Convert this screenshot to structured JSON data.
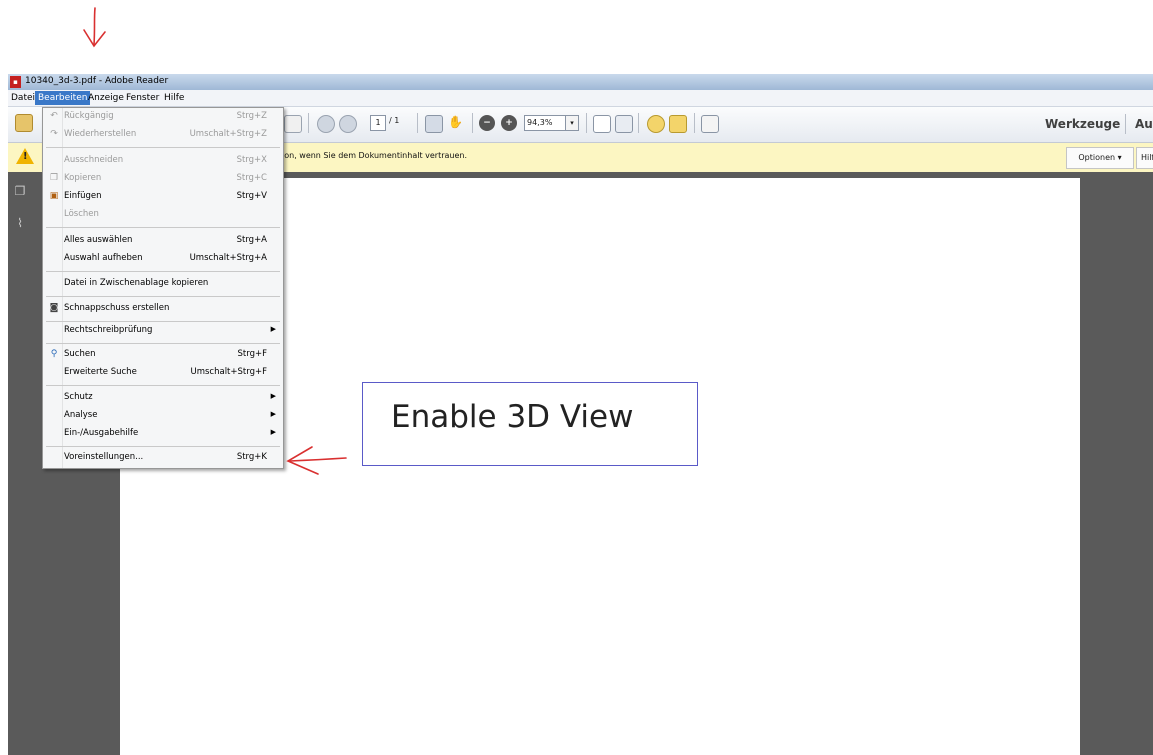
{
  "window": {
    "title": "10340_3d-3.pdf - Adobe Reader",
    "app_icon": "pdf-icon"
  },
  "menubar": {
    "items": [
      "Datei",
      "Bearbeiten",
      "Anzeige",
      "Fenster",
      "Hilfe"
    ],
    "active": "Bearbeiten"
  },
  "toolbar": {
    "page_number": "1",
    "page_total": "/ 1",
    "zoom": "94,3%",
    "zoom_dropdown": "▾",
    "werkzeuge": "Werkzeuge",
    "truncated_right": "Au"
  },
  "message_bar": {
    "text": "ion, wenn Sie dem Dokumentinhalt vertrauen.",
    "options_label": "Optionen ▾",
    "help_label": "Hilfe"
  },
  "document": {
    "box_text": "Enable 3D View"
  },
  "edit_menu": {
    "items": [
      {
        "label": "Rückgängig",
        "shortcut": "Strg+Z",
        "disabled": true,
        "icon": "undo-icon"
      },
      {
        "label": "Wiederherstellen",
        "shortcut": "Umschalt+Strg+Z",
        "disabled": true,
        "icon": "redo-icon"
      },
      {
        "label": "Ausschneiden",
        "shortcut": "Strg+X",
        "disabled": true,
        "icon": ""
      },
      {
        "label": "Kopieren",
        "shortcut": "Strg+C",
        "disabled": true,
        "icon": "copy-icon"
      },
      {
        "label": "Einfügen",
        "shortcut": "Strg+V",
        "disabled": false,
        "icon": "paste-icon"
      },
      {
        "label": "Löschen",
        "shortcut": "",
        "disabled": true,
        "icon": ""
      },
      {
        "label": "Alles auswählen",
        "shortcut": "Strg+A",
        "disabled": false,
        "icon": ""
      },
      {
        "label": "Auswahl aufheben",
        "shortcut": "Umschalt+Strg+A",
        "disabled": false,
        "icon": ""
      },
      {
        "label": "Datei in Zwischenablage kopieren",
        "shortcut": "",
        "disabled": false,
        "icon": ""
      },
      {
        "label": "Schnappschuss erstellen",
        "shortcut": "",
        "disabled": false,
        "icon": "camera-icon"
      },
      {
        "label": "Rechtschreibprüfung",
        "shortcut": "",
        "disabled": false,
        "icon": "",
        "submenu": true
      },
      {
        "label": "Suchen",
        "shortcut": "Strg+F",
        "disabled": false,
        "icon": "search-icon"
      },
      {
        "label": "Erweiterte Suche",
        "shortcut": "Umschalt+Strg+F",
        "disabled": false,
        "icon": ""
      },
      {
        "label": "Schutz",
        "shortcut": "",
        "disabled": false,
        "icon": "",
        "submenu": true
      },
      {
        "label": "Analyse",
        "shortcut": "",
        "disabled": false,
        "icon": "",
        "submenu": true
      },
      {
        "label": "Ein-/Ausgabehilfe",
        "shortcut": "",
        "disabled": false,
        "icon": "",
        "submenu": true
      },
      {
        "label": "Voreinstellungen...",
        "shortcut": "Strg+K",
        "disabled": false,
        "icon": ""
      }
    ]
  },
  "colors": {
    "menu_highlight": "#3a78c8",
    "annotation_red": "#d93030",
    "box_border": "#5a5ac8",
    "message_bar": "#fcf6c2"
  }
}
